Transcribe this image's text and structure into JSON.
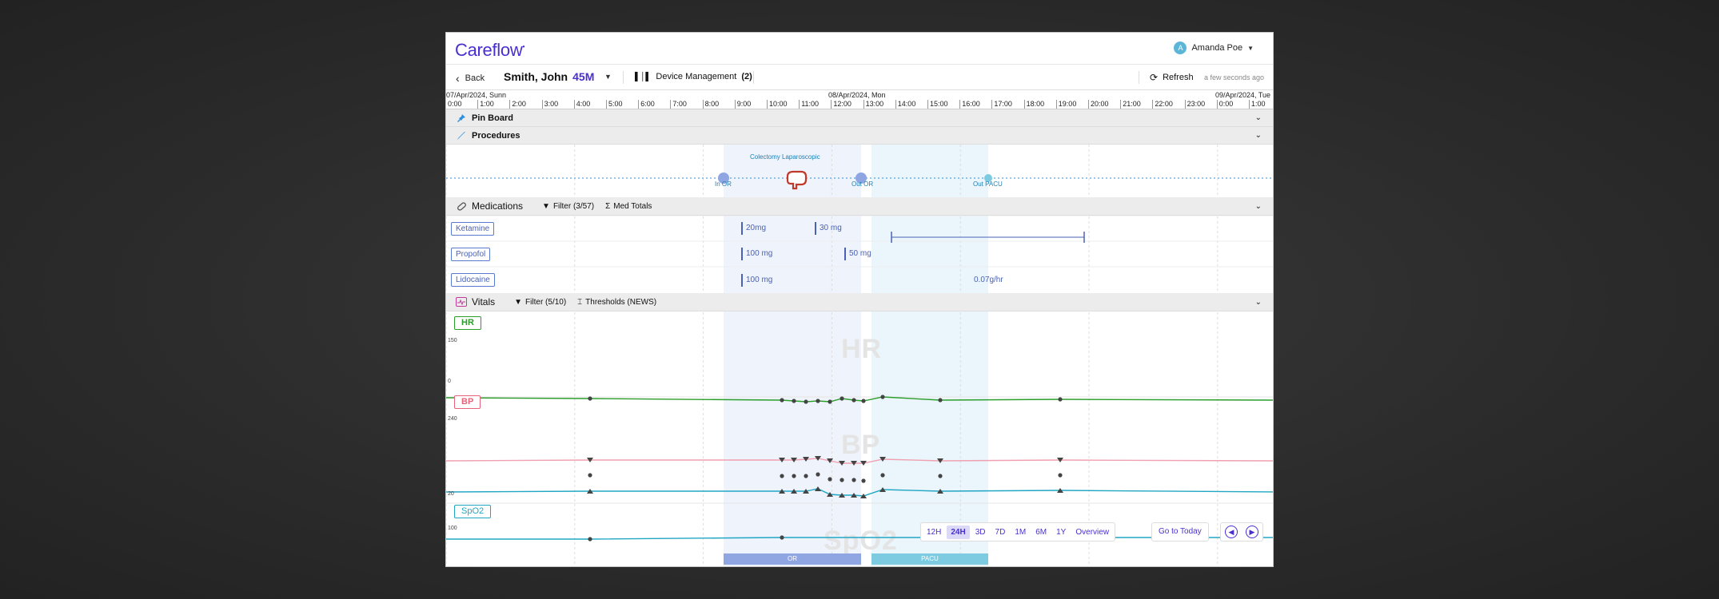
{
  "app": {
    "brand": "Careflow",
    "brand_mark": "•"
  },
  "user": {
    "initial": "A",
    "name": "Amanda Poe"
  },
  "subbar": {
    "back_label": "Back",
    "patient_name": "Smith, John",
    "patient_age": "45M",
    "device_label": "Device Management",
    "device_count": "(2)",
    "refresh_label": "Refresh",
    "refresh_time": "a few seconds ago"
  },
  "timeline": {
    "days": [
      "07/Apr/2024,  Sunn",
      "08/Apr/2024,  Mon",
      "09/Apr/2024,  Tue"
    ],
    "hours": [
      "0:00",
      "1:00",
      "2:00",
      "3:00",
      "4:00",
      "5:00",
      "6:00",
      "7:00",
      "8:00",
      "9:00",
      "10:00",
      "11:00",
      "12:00",
      "13:00",
      "14:00",
      "15:00",
      "16:00",
      "17:00",
      "18:00",
      "19:00",
      "20:00",
      "21:00",
      "22:00",
      "23:00",
      "0:00",
      "1:00"
    ]
  },
  "pinboard": {
    "title": "Pin Board"
  },
  "procedures": {
    "title": "Procedures",
    "procedure_name": "Colectomy Laparoscopic",
    "milestones": [
      "In OR",
      "Out OR",
      "Out PACU"
    ]
  },
  "medications": {
    "title": "Medications",
    "filter_label": "Filter (3/57)",
    "totals_label": "Med Totals",
    "rows": [
      {
        "name": "Ketamine",
        "doses": [
          "20mg",
          "30 mg"
        ]
      },
      {
        "name": "Propofol",
        "doses": [
          "100 mg",
          "50 mg"
        ]
      },
      {
        "name": "Lidocaine",
        "doses": [
          "100 mg"
        ],
        "infusion": "0.07g/hr"
      }
    ]
  },
  "vitals": {
    "title": "Vitals",
    "filter_label": "Filter (5/10)",
    "thresholds_label": "Thresholds (NEWS)",
    "hr": {
      "label": "HR",
      "ymax": "150",
      "ymin": "0",
      "color": "#2a9d2a"
    },
    "bp": {
      "label": "BP",
      "ymax": "240",
      "ymin": "20",
      "color": "#e5647a"
    },
    "spo2": {
      "label": "SpO2",
      "ymax": "100",
      "color": "#21a6c4"
    }
  },
  "zoom": {
    "options": [
      "12H",
      "24H",
      "3D",
      "7D",
      "1M",
      "6M",
      "1Y",
      "Overview"
    ],
    "active": "24H",
    "today_label": "Go to Today"
  },
  "phases": {
    "or": "OR",
    "pacu": "PACU"
  },
  "colors": {
    "brand": "#4a2fd0",
    "or_band": "#8fa6e3",
    "pacu_band": "#7ccbe0"
  }
}
